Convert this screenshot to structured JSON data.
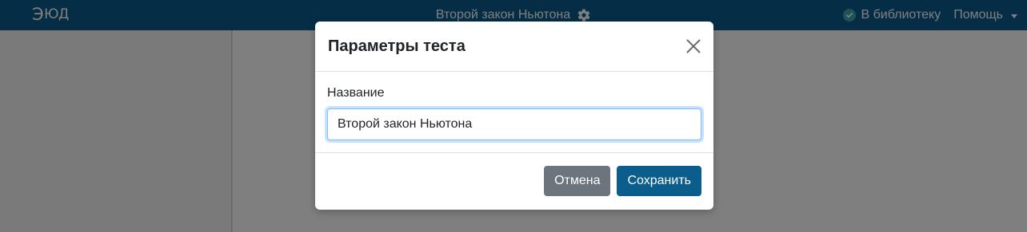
{
  "navbar": {
    "logo_first": "Э",
    "logo_rest": "ЮД",
    "title": "Второй закон Ньютона",
    "title_icon": "gear-icon",
    "library_link": "В библиотеку",
    "library_icon": "check-circle-icon",
    "help_menu": "Помощь"
  },
  "modal": {
    "title": "Параметры теста",
    "close_icon": "close-icon",
    "name_label": "Название",
    "name_value": "Второй закон Ньютона",
    "cancel_label": "Отмена",
    "save_label": "Сохранить"
  },
  "colors": {
    "brand": "#0b5d8c",
    "check_accent": "#3aa9ad",
    "secondary_button": "#6c757d",
    "backdrop": "rgba(0,0,0,0.5)"
  }
}
